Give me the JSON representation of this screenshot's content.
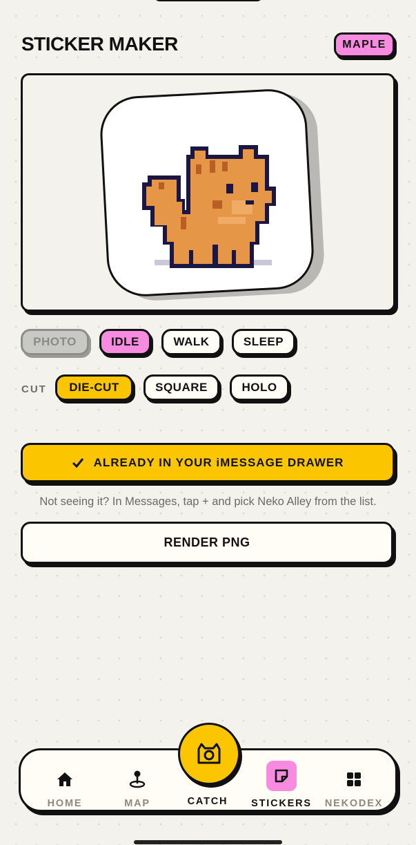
{
  "header": {
    "title": "STICKER MAKER",
    "cat_name": "MAPLE"
  },
  "preview": {
    "sticker_subject": "pixel orange cat"
  },
  "poses": [
    {
      "label": "PHOTO",
      "state": "disabled"
    },
    {
      "label": "IDLE",
      "state": "selected"
    },
    {
      "label": "WALK",
      "state": "default"
    },
    {
      "label": "SLEEP",
      "state": "default"
    }
  ],
  "cut": {
    "label": "CUT",
    "options": [
      {
        "label": "DIE-CUT",
        "state": "selected"
      },
      {
        "label": "SQUARE",
        "state": "default"
      },
      {
        "label": "HOLO",
        "state": "default"
      }
    ]
  },
  "imessage": {
    "button_label": "ALREADY IN YOUR iMESSAGE DRAWER",
    "hint": "Not seeing it? In Messages, tap + and pick Neko Alley from the list."
  },
  "render": {
    "button_label": "RENDER PNG"
  },
  "tabbar": {
    "items": [
      {
        "label": "HOME",
        "icon": "home-icon"
      },
      {
        "label": "MAP",
        "icon": "map-pin-icon"
      },
      {
        "label": "CATCH",
        "icon": "camera-cat-icon"
      },
      {
        "label": "STICKERS",
        "icon": "sticker-icon",
        "active": true
      },
      {
        "label": "NEKODEX",
        "icon": "grid-icon"
      }
    ]
  },
  "colors": {
    "accent_yellow": "#fbc600",
    "accent_pink": "#f68be0",
    "background": "#f3f2ec",
    "ink": "#111111"
  }
}
